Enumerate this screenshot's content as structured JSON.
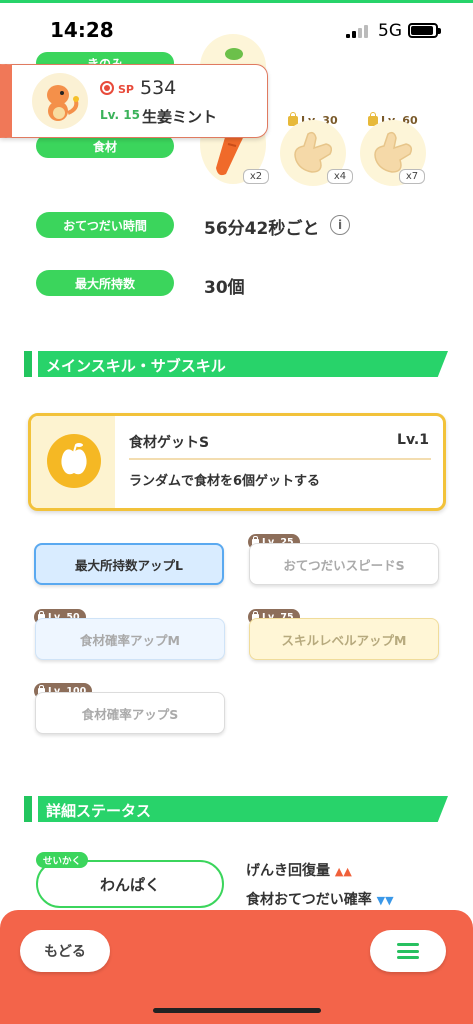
{
  "status_bar": {
    "time": "14:28",
    "network": "5G"
  },
  "pokemon": {
    "sp_label": "SP",
    "sp_value": "534",
    "level": "Lv. 15",
    "nature": "生姜ミント"
  },
  "top_labels": {
    "specialty": "きのみ",
    "ingredients": "食材"
  },
  "ingredients": [
    {
      "name": "carrot",
      "count": "x2",
      "locked_level": ""
    },
    {
      "name": "ginger",
      "count": "x4",
      "locked_level": "Lv. 30"
    },
    {
      "name": "ginger",
      "count": "x7",
      "locked_level": "Lv. 60"
    }
  ],
  "help_time": {
    "label": "おてつだい時間",
    "value": "56分42秒ごと"
  },
  "max_carry": {
    "label": "最大所持数",
    "value": "30個"
  },
  "sections": {
    "skills": "メインスキル・サブスキル",
    "details": "詳細ステータス"
  },
  "main_skill": {
    "name": "食材ゲットS",
    "level": "Lv.1",
    "description": "ランダムで食材を6個ゲットする"
  },
  "sub_skills": [
    {
      "label": "最大所持数アップL",
      "lock_level": ""
    },
    {
      "label": "おてつだいスピードS",
      "lock_level": "Lv. 25"
    },
    {
      "label": "食材確率アップM",
      "lock_level": "Lv. 50"
    },
    {
      "label": "スキルレベルアップM",
      "lock_level": "Lv. 75"
    },
    {
      "label": "食材確率アップS",
      "lock_level": "Lv. 100"
    }
  ],
  "nature_detail": {
    "tag": "せいかく",
    "value": "わんぱく",
    "up_stat": "げんき回復量",
    "down_stat": "食材おてつだい確率"
  },
  "bottom": {
    "back_label": "もどる"
  },
  "colors": {
    "accent_green": "#28d36a",
    "bottom_red": "#f3644a",
    "skill_gold": "#f2c23a"
  }
}
